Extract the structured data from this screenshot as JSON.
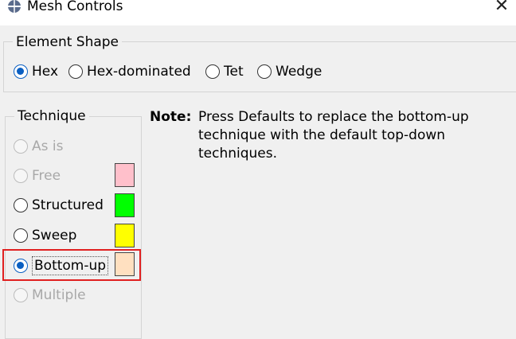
{
  "window": {
    "title": "Mesh Controls",
    "close_symbol": "✕"
  },
  "element_shape": {
    "group_title": "Element Shape",
    "options": [
      {
        "label": "Hex",
        "checked": true
      },
      {
        "label": "Hex-dominated",
        "checked": false
      },
      {
        "label": "Tet",
        "checked": false
      },
      {
        "label": "Wedge",
        "checked": false
      }
    ]
  },
  "technique": {
    "group_title": "Technique",
    "options": [
      {
        "label": "As is",
        "enabled": false,
        "checked": false,
        "swatch": null
      },
      {
        "label": "Free",
        "enabled": false,
        "checked": false,
        "swatch": "#ffc0cb"
      },
      {
        "label": "Structured",
        "enabled": true,
        "checked": false,
        "swatch": "#00ff00"
      },
      {
        "label": "Sweep",
        "enabled": true,
        "checked": false,
        "swatch": "#ffff00"
      },
      {
        "label": "Bottom-up",
        "enabled": true,
        "checked": true,
        "swatch": "#ffe0c0"
      },
      {
        "label": "Multiple",
        "enabled": false,
        "checked": false,
        "swatch": null
      }
    ]
  },
  "note": {
    "label": "Note:",
    "text": "Press Defaults to replace the bottom-up technique with the default top-down techniques."
  },
  "colors": {
    "accent": "#0a5fc2",
    "highlight_border": "#e02020"
  }
}
